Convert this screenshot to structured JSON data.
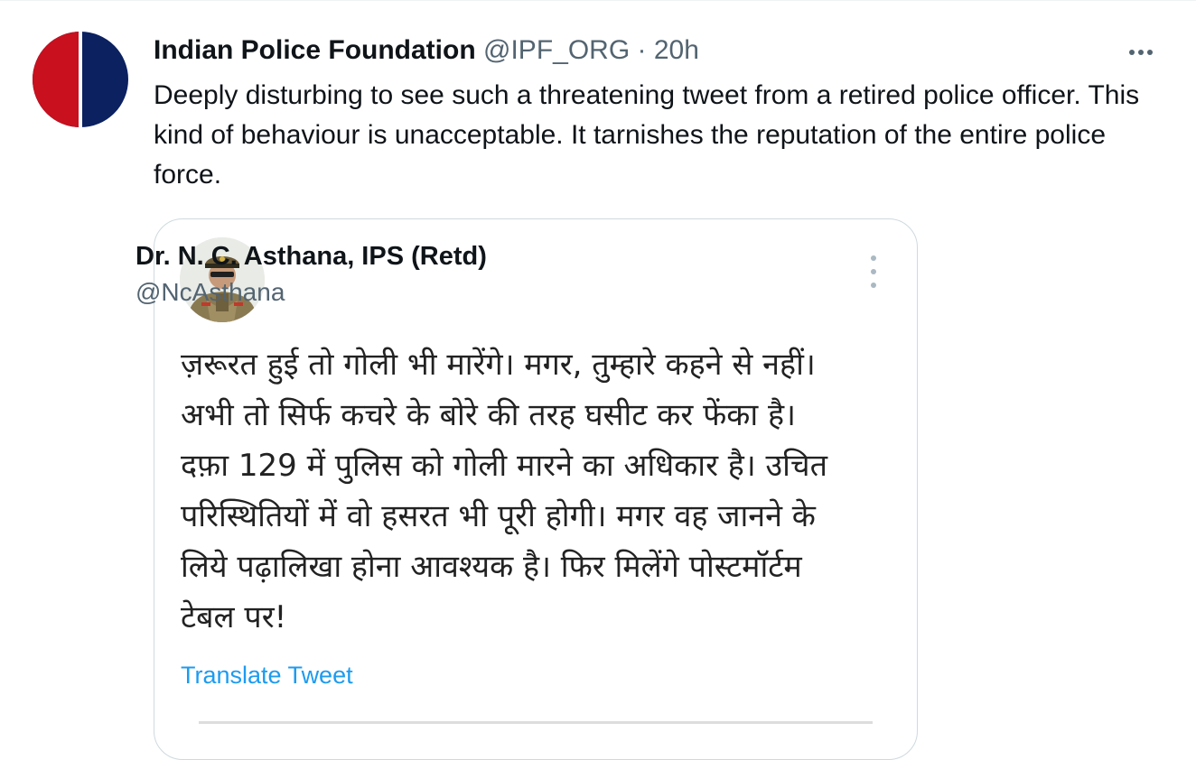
{
  "tweet": {
    "author_name": "Indian Police Foundation",
    "author_handle": "@IPF_ORG",
    "separator": "·",
    "timestamp": "20h",
    "text": "Deeply disturbing to see such a threatening tweet from a retired police officer. This kind of behaviour is unacceptable. It tarnishes the reputation of the entire police force.",
    "more_icon": "ellipsis-icon",
    "avatar_colors": {
      "left": "#c8101e",
      "right": "#0b2160",
      "divider": "#ffffff"
    }
  },
  "quoted_tweet": {
    "author_name": "Dr. N. C. Asthana, IPS (Retd)",
    "author_handle": "@NcAsthana",
    "text_lines": [
      "ज़रूरत हुई तो गोली भी मारेंगे। मगर, तुम्हारे कहने से नहीं।",
      "अभी तो सिर्फ कचरे के बोरे की तरह घसीट कर फेंका है।",
      "दफ़ा 129 में पुलिस को गोली मारने का अधिकार है। उचित",
      "परिस्थितियों में वो हसरत भी पूरी होगी। मगर वह जानने के",
      "लिये पढ़ालिखा होना आवश्यक है। फिर मिलेंगे पोस्टमॉर्टम",
      "टेबल पर!"
    ],
    "translate_label": "Translate Tweet",
    "more_icon": "vertical-ellipsis-icon"
  },
  "colors": {
    "text_primary": "#0f1419",
    "text_secondary": "#536471",
    "link": "#1d9bf0",
    "border": "#cfd9de"
  }
}
